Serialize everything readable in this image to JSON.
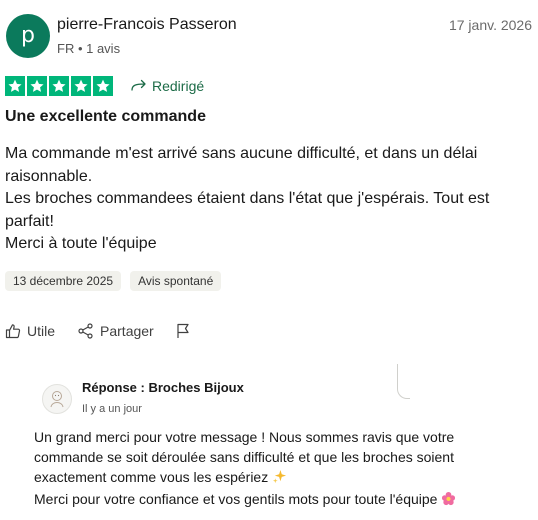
{
  "author": {
    "initial": "p",
    "name": "pierre-Francois Passeron",
    "meta": "FR • 1 avis",
    "avatar_color": "#0b7a5c"
  },
  "review": {
    "date_top": "17 janv. 2026",
    "rating_stars": 5,
    "star_color": "#00b67a",
    "redirect_label": "Redirigé",
    "redirect_color": "#1c6b47",
    "title": "Une excellente commande",
    "body_lines": [
      "Ma commande m'est arrivé sans aucune difficulté, et dans un délai raisonnable.",
      "Les broches commandees étaient dans l'état que j'espérais. Tout est parfait!",
      "Merci à toute l'équipe"
    ],
    "tags": [
      "13 décembre 2025",
      "Avis spontané"
    ]
  },
  "actions": {
    "useful_label": "Utile",
    "share_label": "Partager",
    "flag_icon": "flag-icon"
  },
  "reply": {
    "name": "Réponse : Broches Bijoux",
    "time": "Il y a un jour",
    "body_line1": "Un grand merci pour votre message ! Nous sommes ravis que votre commande se soit déroulée sans difficulté et que les broches soient exactement comme vous les espériez",
    "body_line2": "Merci pour votre confiance et vos gentils mots pour toute l'équipe",
    "emoji1": "sparkles-icon",
    "emoji2": "flower-icon"
  }
}
